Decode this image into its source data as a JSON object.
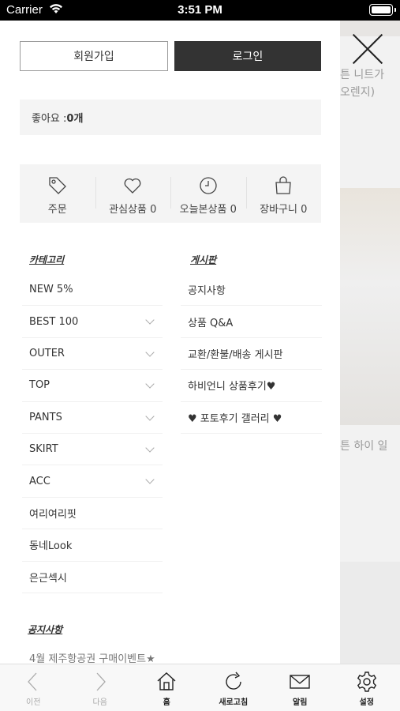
{
  "status_bar": {
    "carrier": "Carrier",
    "time": "3:51 PM"
  },
  "background_page": {
    "text_1": "튼 니트가",
    "text_2": "오렌지)",
    "text_3": "튼 하이 일"
  },
  "auth": {
    "join_label": "회원가입",
    "login_label": "로그인"
  },
  "likes": {
    "label": "좋아요 : ",
    "count": "0개"
  },
  "quick_menu": [
    {
      "label": "주문",
      "icon": "tag-icon"
    },
    {
      "label": "관심상품 0",
      "icon": "heart-icon"
    },
    {
      "label": "오늘본상품 0",
      "icon": "clock-icon"
    },
    {
      "label": "장바구니 0",
      "icon": "bag-icon"
    }
  ],
  "categories": {
    "title": "카테고리",
    "items": [
      {
        "label": "NEW 5%",
        "expandable": false
      },
      {
        "label": "BEST 100",
        "expandable": true
      },
      {
        "label": "OUTER",
        "expandable": true
      },
      {
        "label": "TOP",
        "expandable": true
      },
      {
        "label": "PANTS",
        "expandable": true
      },
      {
        "label": "SKIRT",
        "expandable": true
      },
      {
        "label": "ACC",
        "expandable": true
      },
      {
        "label": "여리여리핏",
        "expandable": false
      },
      {
        "label": "동네Look",
        "expandable": false
      },
      {
        "label": "은근섹시",
        "expandable": false
      }
    ]
  },
  "boards": {
    "title": "게시판",
    "items": [
      {
        "label": "공지사항"
      },
      {
        "label": "상품 Q&A"
      },
      {
        "label": "교환/환불/배송 게시판"
      },
      {
        "label": "하비언니 상품후기♥"
      },
      {
        "label": "♥ 포토후기 갤러리 ♥"
      }
    ]
  },
  "notices": {
    "title": "공지사항",
    "items": [
      {
        "label": "4월 제주항공권 구매이벤트★"
      }
    ]
  },
  "toolbar": {
    "prev": "이전",
    "next": "다음",
    "home": "홈",
    "refresh": "새로고침",
    "notify": "알림",
    "settings": "설정"
  },
  "colors": {
    "login_bg": "#333333",
    "panel_bg": "#f4f4f4",
    "toolbar_bg": "#f8f8f8"
  }
}
